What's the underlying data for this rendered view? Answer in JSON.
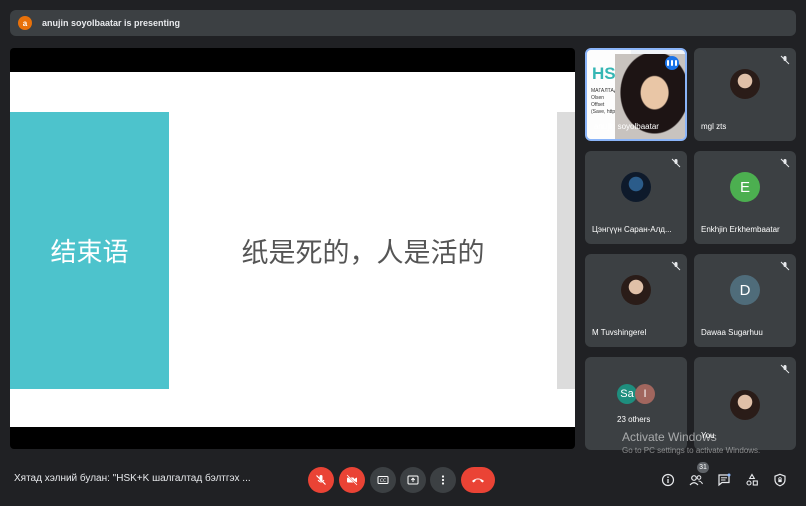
{
  "presenting": {
    "initial": "a",
    "text": "anujin soyolbaatar is presenting"
  },
  "slide": {
    "band_text": "结束语",
    "main_text": "纸是死的，人是活的"
  },
  "self_tile": {
    "name": "anujin soyolbaatar",
    "slide_logo": "HSK",
    "slide_lines": [
      "МАГАЛТАД Б",
      "Olsen",
      "Offset",
      "(Save, http"
    ]
  },
  "tiles": [
    {
      "name": "mgl zts",
      "avatar_text": ""
    },
    {
      "name": "Цэнгүүн Саран-Алд...",
      "avatar_text": ""
    },
    {
      "name": "Enkhjin Erkhembaatar",
      "avatar_text": "E",
      "avatar_color": "#4caf50"
    },
    {
      "name": "M Tuvshingerel",
      "avatar_text": ""
    },
    {
      "name": "Dawaa Sugarhuu",
      "avatar_text": "D",
      "avatar_color": "#4f6c7a"
    },
    {
      "name": "You",
      "avatar_text": ""
    }
  ],
  "others": {
    "label": "23 others",
    "avatars": [
      {
        "text": "Sa",
        "color": "#1e8e7e"
      },
      {
        "text": "I",
        "color": "#a1665e"
      }
    ]
  },
  "watermark": {
    "title": "Activate Windows",
    "subtitle": "Go to PC settings to activate Windows."
  },
  "bottom": {
    "meeting_title": "Хятад хэлний булан: \"HSK+K шалгалтад бэлтгэх ...",
    "participants_count": "31"
  },
  "colors": {
    "accent": "#8ab4f8",
    "danger": "#ea4335",
    "slide_band": "#4dc3cc"
  }
}
